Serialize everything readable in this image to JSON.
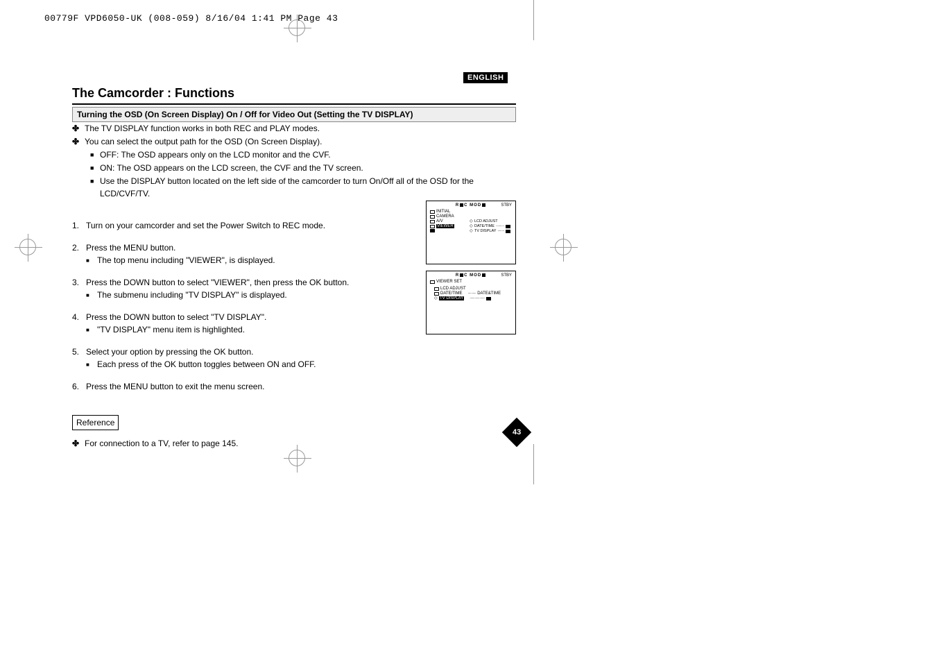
{
  "header": {
    "line": "00779F VPD6050-UK (008-059)  8/16/04 1:41 PM  Page 43"
  },
  "lang": "ENGLISH",
  "title": "The Camcorder : Functions",
  "subtitle": "Turning the OSD (On Screen Display) On / Off for Video Out (Setting the TV DISPLAY)",
  "intro": {
    "i1": "The TV DISPLAY function works in both REC and PLAY modes.",
    "i2": "You can select the output path for the OSD (On Screen Display).",
    "s1": "OFF: The OSD appears only on the LCD monitor and the CVF.",
    "s2": "ON: The OSD appears on the LCD screen, the CVF and the TV screen.",
    "s3": "Use the DISPLAY button located on the left side of the camcorder to turn On/Off all of the OSD for the LCD/CVF/TV."
  },
  "steps": {
    "st1": {
      "num": "1.",
      "text": "Turn on your camcorder and set the Power Switch to REC mode."
    },
    "st2": {
      "num": "2.",
      "text": "Press the MENU button.",
      "sub": "The top menu including \"VIEWER\", is displayed."
    },
    "st3": {
      "num": "3.",
      "text": "Press the DOWN button to select \"VIEWER\", then press the OK button.",
      "sub": "The submenu including \"TV DISPLAY\" is displayed."
    },
    "st4": {
      "num": "4.",
      "text": "Press the DOWN button to select \"TV DISPLAY\".",
      "sub": "\"TV DISPLAY\" menu item is highlighted."
    },
    "st5": {
      "num": "5.",
      "text": "Select your option by pressing the OK button.",
      "sub": "Each press of the OK button toggles between ON and OFF."
    },
    "st6": {
      "num": "6.",
      "text": "Press the MENU button to exit the menu screen."
    }
  },
  "reference": {
    "label": "Reference",
    "text": "For connection to a TV, refer to page 145."
  },
  "osd1": {
    "mode": "REC MODE",
    "stby": "STBY",
    "left": [
      "INITIAL",
      "CAMERA",
      "A/V",
      "VIEWER"
    ],
    "right": [
      "LCD ADJUST",
      "DATE/TIME",
      "TV DISPLAY"
    ]
  },
  "osd2": {
    "mode": "REC MODE",
    "stby": "STBY",
    "set": "VIEWER SET",
    "items": {
      "a": "LCD ADJUST",
      "b": "DATE/TIME",
      "bval": "DATE&TIME",
      "c": "TV DISPLAY"
    }
  },
  "page_number": "43"
}
